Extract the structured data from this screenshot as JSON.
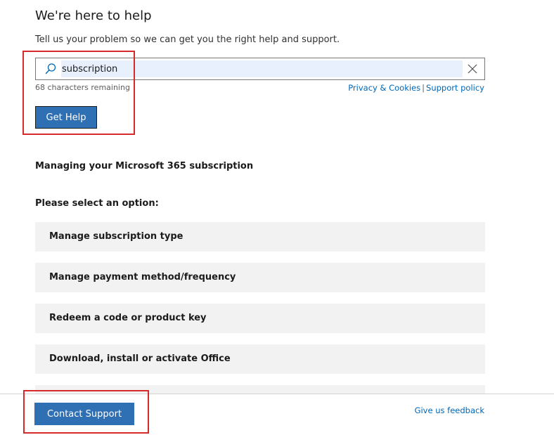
{
  "header": {
    "title": "We're here to help",
    "subtitle": "Tell us your problem so we can get you the right help and support."
  },
  "search": {
    "value": "subscription",
    "remaining": "68 characters remaining",
    "icon": "search-icon",
    "clear_icon": "close-icon"
  },
  "links": {
    "privacy": "Privacy & Cookies",
    "separator": "|",
    "support_policy": "Support policy"
  },
  "get_help_label": "Get Help",
  "topic": {
    "heading": "Managing your Microsoft 365 subscription",
    "prompt": "Please select an option:"
  },
  "options": [
    {
      "label": "Manage subscription type"
    },
    {
      "label": "Manage payment method/frequency"
    },
    {
      "label": "Redeem a code or product key"
    },
    {
      "label": "Download, install or activate Office"
    },
    {
      "label": ""
    }
  ],
  "footer": {
    "contact_label": "Contact Support",
    "feedback_label": "Give us feedback"
  },
  "colors": {
    "primary_button": "#2f6fb4",
    "link": "#0067b8",
    "option_bg": "#f2f2f2",
    "highlight": "#d62a2a",
    "input_autofill": "#e8f0fe"
  }
}
